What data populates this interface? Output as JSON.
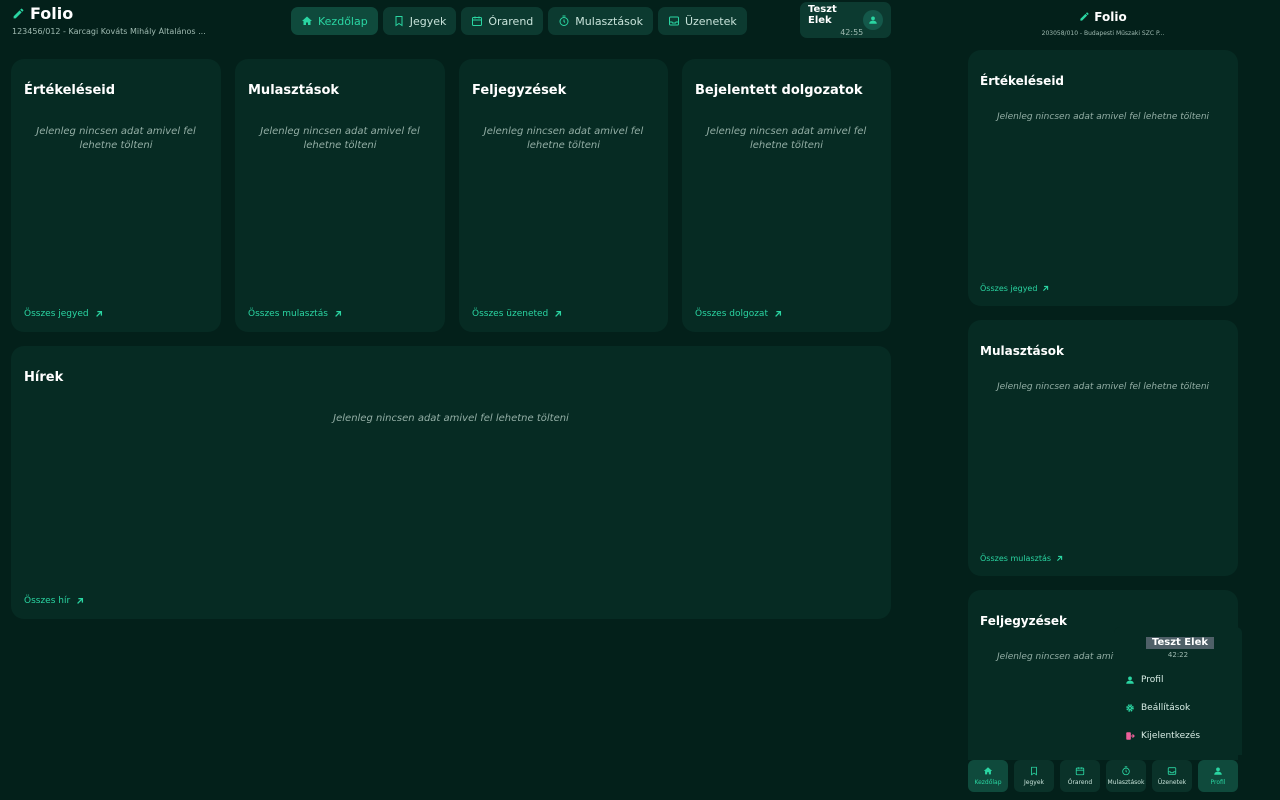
{
  "header": {
    "app_name": "Folio",
    "school_line": "123456/012 - Karcagi Kováts Mihály Általános ..."
  },
  "nav": {
    "home": "Kezdőlap",
    "grades": "Jegyek",
    "timetable": "Órarend",
    "absences": "Mulasztások",
    "messages": "Üzenetek"
  },
  "user": {
    "name": "Teszt Elek",
    "timer": "42:55"
  },
  "cards": {
    "grades": {
      "title": "Értékeléseid",
      "empty": "Jelenleg nincsen adat amivel fel lehetne tölteni",
      "link": "Összes jegyed"
    },
    "absences": {
      "title": "Mulasztások",
      "empty": "Jelenleg nincsen adat amivel fel lehetne tölteni",
      "link": "Összes mulasztás"
    },
    "notes": {
      "title": "Feljegyzések",
      "empty": "Jelenleg nincsen adat amivel fel lehetne tölteni",
      "link": "Összes üzeneted"
    },
    "exams": {
      "title": "Bejelentett dolgozatok",
      "empty": "Jelenleg nincsen adat amivel fel lehetne tölteni",
      "link": "Összes dolgozat"
    },
    "news": {
      "title": "Hírek",
      "empty": "Jelenleg nincsen adat amivel fel lehetne tölteni",
      "link": "Összes hír"
    }
  },
  "mobile": {
    "app_name": "Folio",
    "school_line": "203058/010 - Budapesti Műszaki SZC P...",
    "cards": {
      "grades": {
        "title": "Értékeléseid",
        "empty": "Jelenleg nincsen adat amivel fel lehetne tölteni",
        "link": "Összes jegyed"
      },
      "absences": {
        "title": "Mulasztások",
        "empty": "Jelenleg nincsen adat amivel fel lehetne tölteni",
        "link": "Összes mulasztás"
      },
      "notes": {
        "title": "Feljegyzések",
        "empty": "Jelenleg nincsen adat amivel fel"
      }
    },
    "menu": {
      "name": "Teszt Elek",
      "timer": "42:22",
      "profile": "Profil",
      "settings": "Beállítások",
      "logout": "Kijelentkezés"
    },
    "nav": {
      "home": "Kezdőlap",
      "grades": "Jegyek",
      "timetable": "Órarend",
      "absences": "Mulasztások",
      "messages": "Üzenetek",
      "profile": "Profil"
    }
  },
  "colors": {
    "background": "#03201a",
    "card": "#062b23",
    "accent": "#2ad5a2",
    "logout_icon": "#ec5f9a"
  },
  "icons": {
    "brand": "pencil-icon",
    "home": "home-icon",
    "grades": "bookmark-icon",
    "timetable": "calendar-icon",
    "absences": "stopwatch-icon",
    "messages": "inbox-icon",
    "user": "user-icon",
    "link": "arrow-up-right-icon",
    "settings": "gear-icon",
    "logout": "logout-icon"
  }
}
